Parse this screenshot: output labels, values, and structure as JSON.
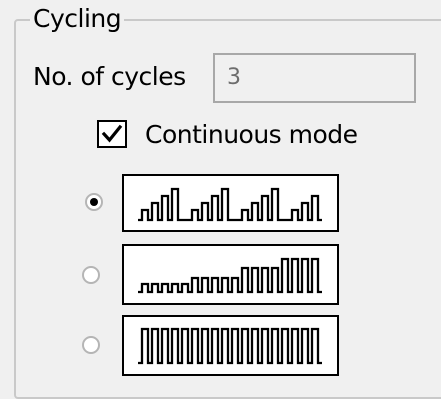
{
  "group": {
    "title": "Cycling"
  },
  "cycles": {
    "label": "No. of cycles",
    "value": "3"
  },
  "continuous_mode": {
    "label": "Continuous mode",
    "checked": true
  },
  "patterns": [
    {
      "name": "grouped-burst-pattern",
      "selected": true
    },
    {
      "name": "ramping-pulse-pattern",
      "selected": false
    },
    {
      "name": "uniform-pulse-pattern",
      "selected": false
    }
  ],
  "colors": {
    "background": "#f0f0f0",
    "field_text": "#6d6d6d",
    "border": "#c9c9c9"
  }
}
